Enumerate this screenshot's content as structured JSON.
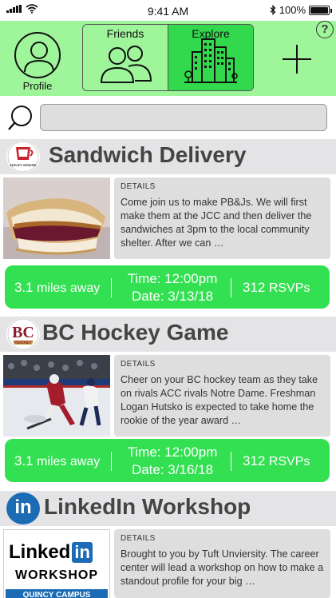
{
  "status_bar": {
    "time": "9:41 AM",
    "battery_text": "100%",
    "battery_level": 1.0,
    "bluetooth_icon": "bluetooth-icon",
    "wifi_icon": "wifi-icon"
  },
  "header": {
    "profile_label": "Profile",
    "tabs": [
      {
        "label": "Friends",
        "icon": "friends-icon",
        "active": false
      },
      {
        "label": "Explore",
        "icon": "city-icon",
        "active": true
      }
    ],
    "add_icon": "plus-icon",
    "help_label": "?"
  },
  "search": {
    "icon": "search-icon",
    "placeholder": ""
  },
  "events": [
    {
      "title": "Sandwich Delivery",
      "logo_text": "HALEY HOUSE",
      "details_label": "DETAILS",
      "details": "Come join us to make PB&Js. We will first make them at the JCC and then deliver the sandwiches at 3pm to the local community shelter. After we can …",
      "distance_value": "3.1",
      "distance_unit": "miles away",
      "time": "Time: 12:00pm",
      "date": "Date: 3/13/18",
      "rsvp_count": "312",
      "rsvp_label": "RSVPs"
    },
    {
      "title": "BC Hockey Game",
      "logo_text": "HOCKEY",
      "details_label": "DETAILS",
      "details": "Cheer on your BC hockey team as they take on rivals ACC rivals Notre Dame. Freshman Logan Hutsko is expected to take home the rookie of the year award …",
      "distance_value": "3.1",
      "distance_unit": "miles away",
      "time": "Time: 12:00pm",
      "date": "Date: 3/16/18",
      "rsvp_count": "312",
      "rsvp_label": "RSVPs"
    },
    {
      "title": "LinkedIn Workshop",
      "logo_text": "in",
      "image_text_1": "Linked",
      "image_text_in": "in",
      "image_text_2": "WORKSHOP",
      "image_text_3": "QUINCY CAMPUS",
      "details_label": "DETAILS",
      "details": "Brought to you by Tuft Unviersity. The career center will lead a workshop on how to make a standout profile for your big …"
    }
  ],
  "colors": {
    "header_green": "#9ef59a",
    "active_green": "#33d94c",
    "stats_green": "#33e051",
    "title_bar_gray": "#e4e4e6"
  }
}
